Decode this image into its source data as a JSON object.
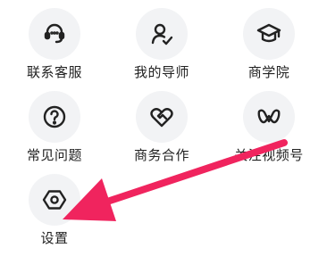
{
  "grid": {
    "items": [
      {
        "label": "联系客服",
        "icon": "headset-icon"
      },
      {
        "label": "我的导师",
        "icon": "user-check-icon"
      },
      {
        "label": "商学院",
        "icon": "graduation-cap-icon"
      },
      {
        "label": "常见问题",
        "icon": "question-circle-icon"
      },
      {
        "label": "商务合作",
        "icon": "handshake-heart-icon"
      },
      {
        "label": "关注视频号",
        "icon": "video-account-icon"
      },
      {
        "label": "设置",
        "icon": "hexagon-settings-icon"
      }
    ]
  },
  "colors": {
    "icon_stroke": "#222222",
    "icon_bg": "#f2f3f5",
    "label_text": "#222222",
    "arrow": "#f0245e"
  }
}
